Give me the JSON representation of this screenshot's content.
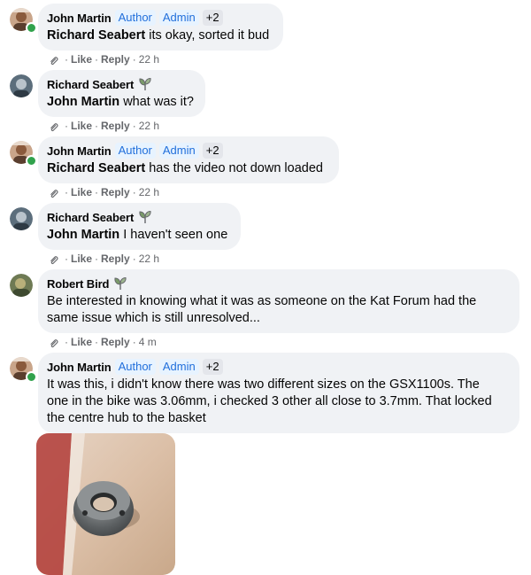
{
  "comments": [
    {
      "author": "John Martin",
      "badges": [
        "Author",
        "Admin"
      ],
      "more_badges": "+2",
      "mention": "Richard Seabert",
      "text": " its okay, sorted it bud",
      "like": "Like",
      "reply": "Reply",
      "time": "22 h"
    },
    {
      "author": "Richard Seabert",
      "mention": "John Martin",
      "text": " what was it?",
      "like": "Like",
      "reply": "Reply",
      "time": "22 h"
    },
    {
      "author": "John Martin",
      "badges": [
        "Author",
        "Admin"
      ],
      "more_badges": "+2",
      "mention": "Richard Seabert",
      "text": " has the video not down loaded",
      "like": "Like",
      "reply": "Reply",
      "time": "22 h"
    },
    {
      "author": "Richard Seabert",
      "mention": "John Martin",
      "text": " I haven't seen one",
      "like": "Like",
      "reply": "Reply",
      "time": "22 h"
    },
    {
      "author": "Robert Bird",
      "text_line1": "Be interested in knowing what it was as someone on the Kat Forum had the",
      "text_line2": "same issue which is still unresolved...",
      "like": "Like",
      "reply": "Reply",
      "time": "4 m"
    },
    {
      "author": "John Martin",
      "badges": [
        "Author",
        "Admin"
      ],
      "more_badges": "+2",
      "text_line1": "It was this, i didn't know there was two different sizes on the GSX1100s. The",
      "text_line2": "one in the bike was 3.06mm, i checked 3 other all close to 3.7mm. That locked",
      "text_line3": "the centre hub to the basket"
    }
  ],
  "colors": {
    "bubble": "#f0f2f5",
    "badge_text": "#216fdb",
    "badge_bg": "#e7f3ff",
    "meta": "#65676b",
    "online": "#31a24c"
  },
  "icons": {
    "edit_history": "paperclip-link-icon",
    "new_member": "sprout-icon"
  }
}
